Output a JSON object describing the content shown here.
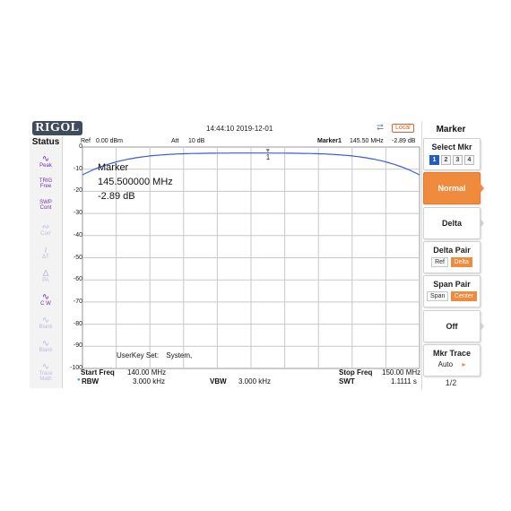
{
  "header": {
    "logo": "RIGOL",
    "datetime": "14:44:10 2019-12-01",
    "usb_icon": "usb-icon",
    "local": "Local"
  },
  "status": {
    "title": "Status",
    "items": [
      {
        "icon": "peak-detector-icon",
        "line1": "Peak",
        "state": "on"
      },
      {
        "icon": "trigger-icon",
        "line1": "TRIG",
        "line2": "Free",
        "state": "on"
      },
      {
        "icon": "sweep-icon",
        "line1": "SWP",
        "line2": "Cont",
        "state": "on"
      },
      {
        "icon": "correction-icon",
        "line1": "Corr",
        "state": "dim"
      },
      {
        "icon": "attenuation-icon",
        "line1": "ΔT",
        "state": "dim"
      },
      {
        "icon": "preamp-icon",
        "line1": "PA",
        "state": "dim"
      },
      {
        "icon": "clear-write-icon",
        "line1": "C W",
        "state": "on"
      },
      {
        "icon": "blank-trace-icon",
        "line1": "Blank",
        "state": "dim"
      },
      {
        "icon": "blank-trace-icon",
        "line1": "Blank",
        "state": "dim"
      },
      {
        "icon": "trace-math-icon",
        "line1": "Trace",
        "line2": "Math",
        "state": "dim"
      }
    ]
  },
  "plot": {
    "ref_label": "Ref",
    "ref_value": "0.00 dBm",
    "att_label": "Att",
    "att_value": "10 dB",
    "marker_label": "Marker1",
    "marker_freq": "145.50 MHz",
    "marker_level": "-2.89 dB",
    "y_ticks": [
      "0",
      "-10",
      "-20",
      "-30",
      "-40",
      "-50",
      "-60",
      "-70",
      "-80",
      "-90",
      "-100"
    ],
    "marker_number": "1",
    "trace_color": "#3a5bd6",
    "grid_color": "#c8c8c8"
  },
  "marker_readout": {
    "title": "Marker",
    "freq": "145.500000 MHz",
    "level": "-2.89 dB"
  },
  "userkey": {
    "label": "UserKey Set:",
    "value": "System,"
  },
  "bottom": {
    "start_label": "Start Freq",
    "start_value": "140.00 MHz",
    "stop_label": "Stop Freq",
    "stop_value": "150.00 MHz",
    "rbw_label": "RBW",
    "rbw_value": "3.000 kHz",
    "vbw_label": "VBW",
    "vbw_value": "3.000 kHz",
    "swt_label": "SWT",
    "swt_value": "1.1111 s"
  },
  "menu": {
    "title": "Marker",
    "select_mkr": {
      "label": "Select Mkr",
      "options": [
        "1",
        "2",
        "3",
        "4"
      ],
      "selected": "1"
    },
    "normal": "Normal",
    "delta": "Delta",
    "delta_pair": {
      "label": "Delta Pair",
      "opt1": "Ref",
      "opt2": "Delta",
      "selected": "Delta"
    },
    "span_pair": {
      "label": "Span Pair",
      "opt1": "Span",
      "opt2": "Center",
      "selected": "Center"
    },
    "off": "Off",
    "mkr_trace": {
      "label": "Mkr Trace",
      "value": "Auto"
    },
    "page": "1/2"
  }
}
